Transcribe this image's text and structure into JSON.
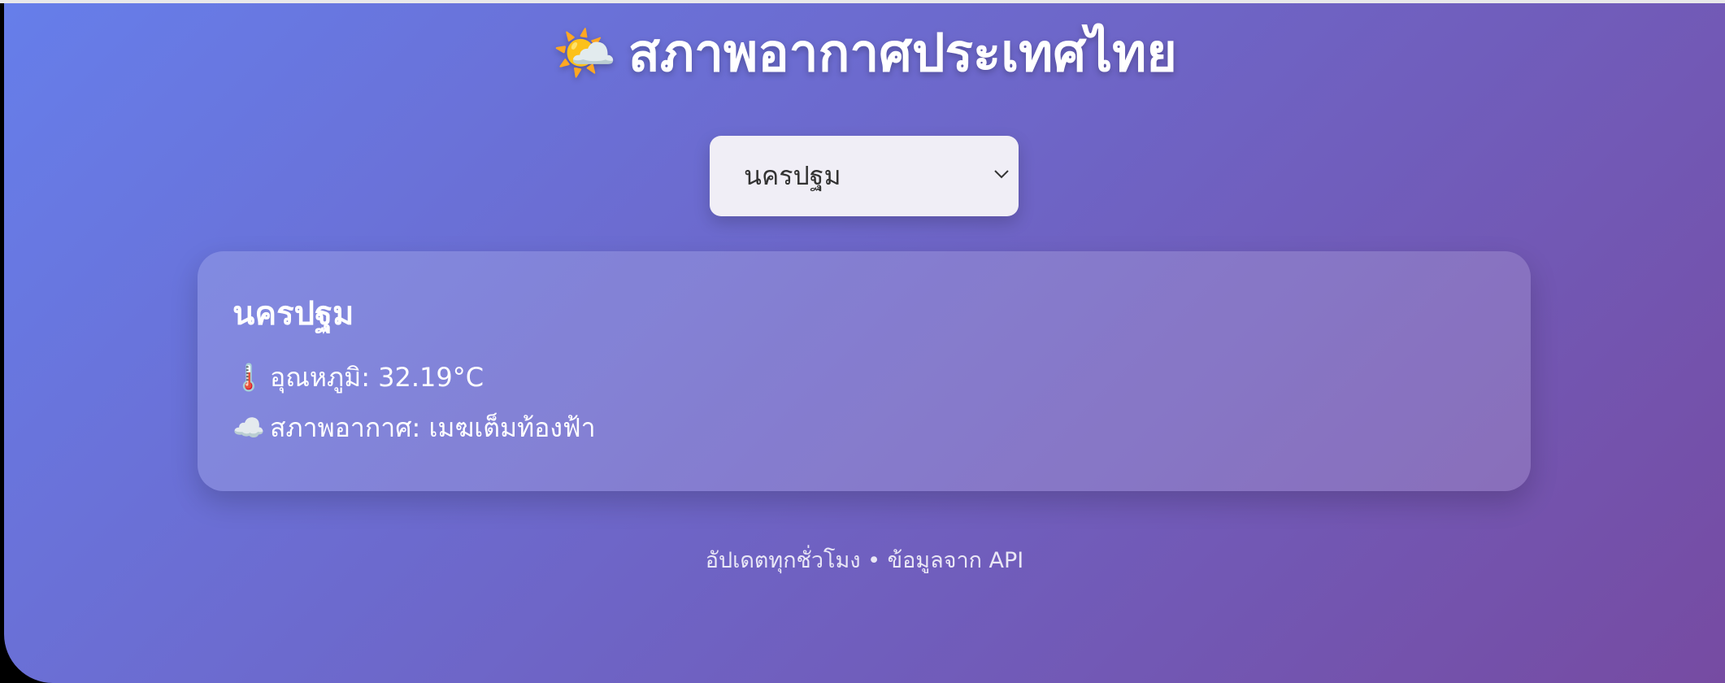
{
  "header": {
    "icon": "sun-behind-cloud-icon",
    "icon_glyph": "🌤️",
    "title": "สภาพอากาศประเทศไทย"
  },
  "province_select": {
    "selected": "นครปฐม",
    "icon": "chevron-down-icon"
  },
  "weather_card": {
    "city": "นครปฐม",
    "temperature": {
      "icon": "thermometer-icon",
      "icon_glyph": "🌡️",
      "text": "อุณหภูมิ: 32.19°C"
    },
    "condition": {
      "icon": "cloud-icon",
      "icon_glyph": "☁️",
      "text": "สภาพอากาศ: เมฆเต็มท้องฟ้า"
    }
  },
  "footer": {
    "text": "อัปเดตทุกชั่วโมง • ข้อมูลจาก API"
  },
  "colors": {
    "gradient_start": "#667eea",
    "gradient_end": "#764ba2",
    "select_bg": "#f0eef6",
    "text_primary": "#ffffff"
  }
}
